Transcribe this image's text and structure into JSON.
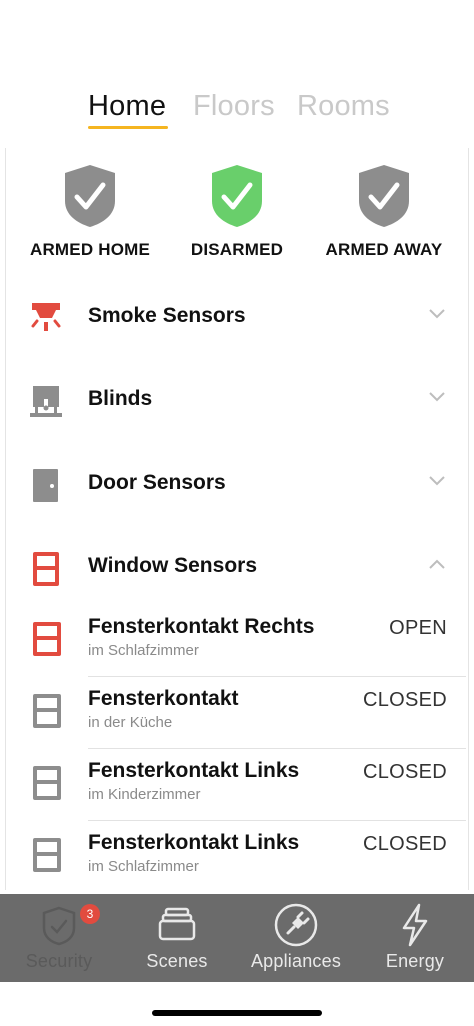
{
  "tabs": [
    {
      "label": "Home",
      "active": true
    },
    {
      "label": "Floors",
      "active": false
    },
    {
      "label": "Rooms",
      "active": false
    }
  ],
  "modes": [
    {
      "label": "ARMED HOME",
      "color": "#8d8d8d",
      "icon": "shield-check-icon"
    },
    {
      "label": "DISARMED",
      "color": "#69cf6b",
      "icon": "shield-check-icon"
    },
    {
      "label": "ARMED AWAY",
      "color": "#8d8d8d",
      "icon": "shield-check-icon"
    }
  ],
  "sections": [
    {
      "title": "Smoke Sensors",
      "icon": "smoke-detector-icon",
      "expanded": false
    },
    {
      "title": "Blinds",
      "icon": "blinds-icon",
      "expanded": false
    },
    {
      "title": "Door Sensors",
      "icon": "door-icon",
      "expanded": false
    },
    {
      "title": "Window Sensors",
      "icon": "window-icon",
      "expanded": true
    }
  ],
  "window_sensors": [
    {
      "name": "Fensterkontakt Rechts",
      "room": "im Schlafzimmer",
      "state": "OPEN",
      "alert": true
    },
    {
      "name": "Fensterkontakt",
      "room": "in der Küche",
      "state": "CLOSED",
      "alert": false
    },
    {
      "name": "Fensterkontakt Links",
      "room": "im Kinderzimmer",
      "state": "CLOSED",
      "alert": false
    },
    {
      "name": "Fensterkontakt Links",
      "room": "im Schlafzimmer",
      "state": "CLOSED",
      "alert": false
    }
  ],
  "bottom_nav": [
    {
      "label": "Security",
      "icon": "shield-icon",
      "active": true,
      "badge": "3"
    },
    {
      "label": "Scenes",
      "icon": "scenes-icon",
      "active": false
    },
    {
      "label": "Appliances",
      "icon": "plug-icon",
      "active": false
    },
    {
      "label": "Energy",
      "icon": "lightning-icon",
      "active": false
    }
  ],
  "colors": {
    "accent": "#f5b520",
    "alert": "#e24b3f",
    "ok": "#69cf6b",
    "neutral": "#8d8d8d",
    "nav_bg": "#6b6b6b"
  }
}
